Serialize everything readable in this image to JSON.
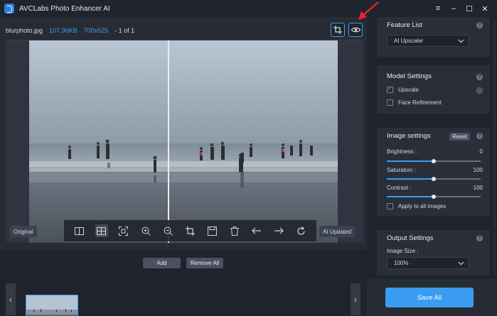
{
  "window": {
    "title": "AVCLabs Photo Enhancer AI"
  },
  "file": {
    "name": "blurphoto.jpg",
    "size": "107.96KB",
    "dimensions": "700x525",
    "count": "- 1 of 1"
  },
  "viewer": {
    "original_label": "Original",
    "updated_label": "AI Updated"
  },
  "toolbar_icons": [
    "split-view-icon",
    "grid-view-icon",
    "fit-screen-icon",
    "zoom-in-icon",
    "zoom-out-icon",
    "crop-icon",
    "save-icon",
    "delete-icon",
    "previous-arrow-icon",
    "next-arrow-icon",
    "rotate-icon"
  ],
  "top_tools": [
    "crop-icon",
    "eye-icon"
  ],
  "thumbs": {
    "add_label": "Add",
    "remove_label": "Remove All"
  },
  "panel": {
    "feature": {
      "title": "Feature List",
      "selected": "AI Upscaler"
    },
    "model": {
      "title": "Model Settings",
      "upscale": "Upscale",
      "upscale_checked": true,
      "face": "Face Refinement",
      "face_checked": false
    },
    "image": {
      "title": "Image settings",
      "reset": "Reset",
      "brightness": {
        "label": "Brightness :",
        "value": "0",
        "fraction": 0.5
      },
      "saturation": {
        "label": "Saturation :",
        "value": "100",
        "fraction": 0.5
      },
      "contrast": {
        "label": "Contrast :",
        "value": "100",
        "fraction": 0.5
      },
      "apply_all": "Apply to all images"
    },
    "output": {
      "title": "Output Settings",
      "size_label": "Image Size :",
      "size_value": "100%"
    },
    "save_label": "Save All"
  },
  "colors": {
    "accent": "#3a9cf0",
    "annotation": "#e8242a"
  }
}
